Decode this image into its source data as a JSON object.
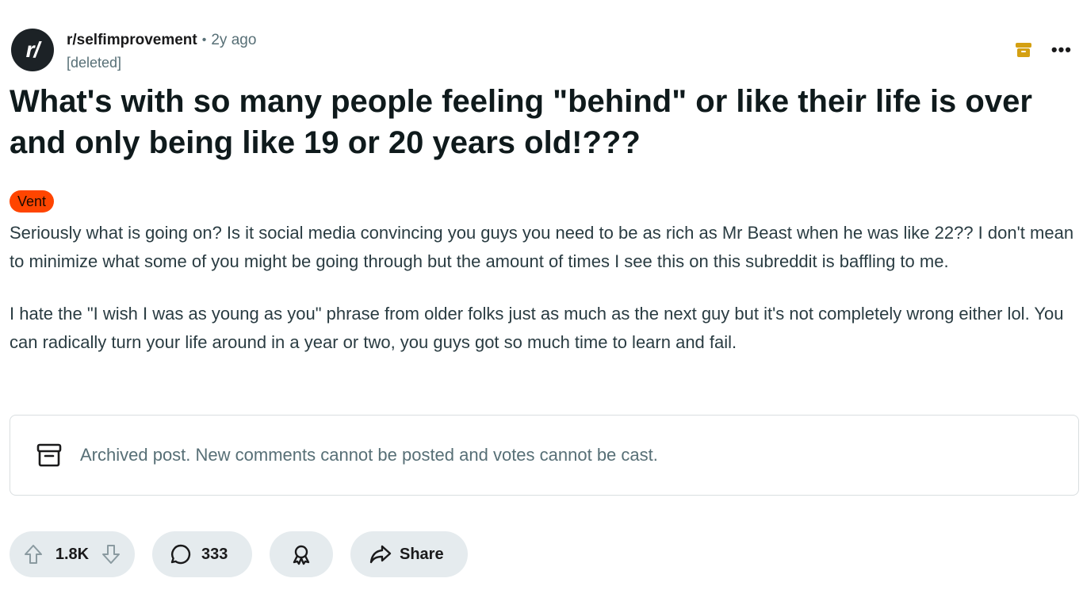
{
  "post": {
    "subreddit": "r/selfimprovement",
    "separator": "•",
    "age": "2y ago",
    "author": "[deleted]",
    "avatar_text": "r/",
    "title": "What's with so many people feeling \"behind\" or like their life is over and only being like 19 or 20 years old!???",
    "flair": "Vent",
    "body": [
      "Seriously what is going on? Is it social media convincing you guys you need to be as rich as Mr Beast when he was like 22?? I don't mean to minimize what some of you might be going through but the amount of times I see this on this subreddit is baffling to me.",
      "I hate the \"I wish I was as young as you\" phrase from older folks just as much as the next guy but it's not completely wrong either lol. You can radically turn your life around in a year or two, you guys got so much time to learn and fail."
    ]
  },
  "top_actions": {
    "archive_icon": "archive-icon",
    "more_label": "•••"
  },
  "archived_notice": {
    "icon": "archive-icon",
    "text": "Archived post. New comments cannot be posted and votes cannot be cast."
  },
  "actions": {
    "score": "1.8K",
    "comments": "333",
    "share_label": "Share",
    "upvote_icon": "upvote-arrow-icon",
    "downvote_icon": "downvote-arrow-icon",
    "comment_icon": "comment-bubble-icon",
    "award_icon": "award-icon",
    "share_icon": "share-arrow-icon"
  },
  "colors": {
    "flair_bg": "#ff4500",
    "archive_badge": "#d4a012",
    "pill_bg": "#e5ebee",
    "muted_text": "#576f76"
  }
}
